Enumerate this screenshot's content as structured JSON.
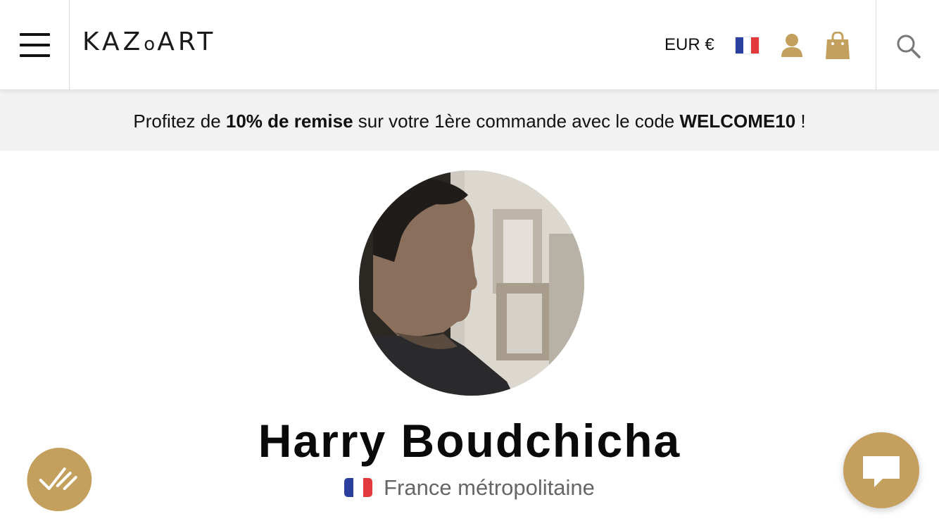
{
  "header": {
    "logo_text": "KAZoART",
    "currency_label": "EUR €",
    "flag_colors": [
      "#2b3f9e",
      "#ffffff",
      "#e2393d"
    ]
  },
  "promo": {
    "prefix": "Profitez de ",
    "discount": "10% de remise",
    "middle": " sur votre 1ère commande avec le code ",
    "code": "WELCOME10",
    "suffix": " !"
  },
  "artist": {
    "name": "Harry Boudchicha",
    "location": "France métropolitaine"
  },
  "colors": {
    "accent": "#c3a05d",
    "promo_bg": "#f2f2f2"
  },
  "icons": {
    "menu": "hamburger-menu-icon",
    "account": "user-icon",
    "cart": "shopping-bag-icon",
    "search": "search-icon",
    "chat": "chat-bubble-icon",
    "review": "checkmark-badge-icon"
  }
}
